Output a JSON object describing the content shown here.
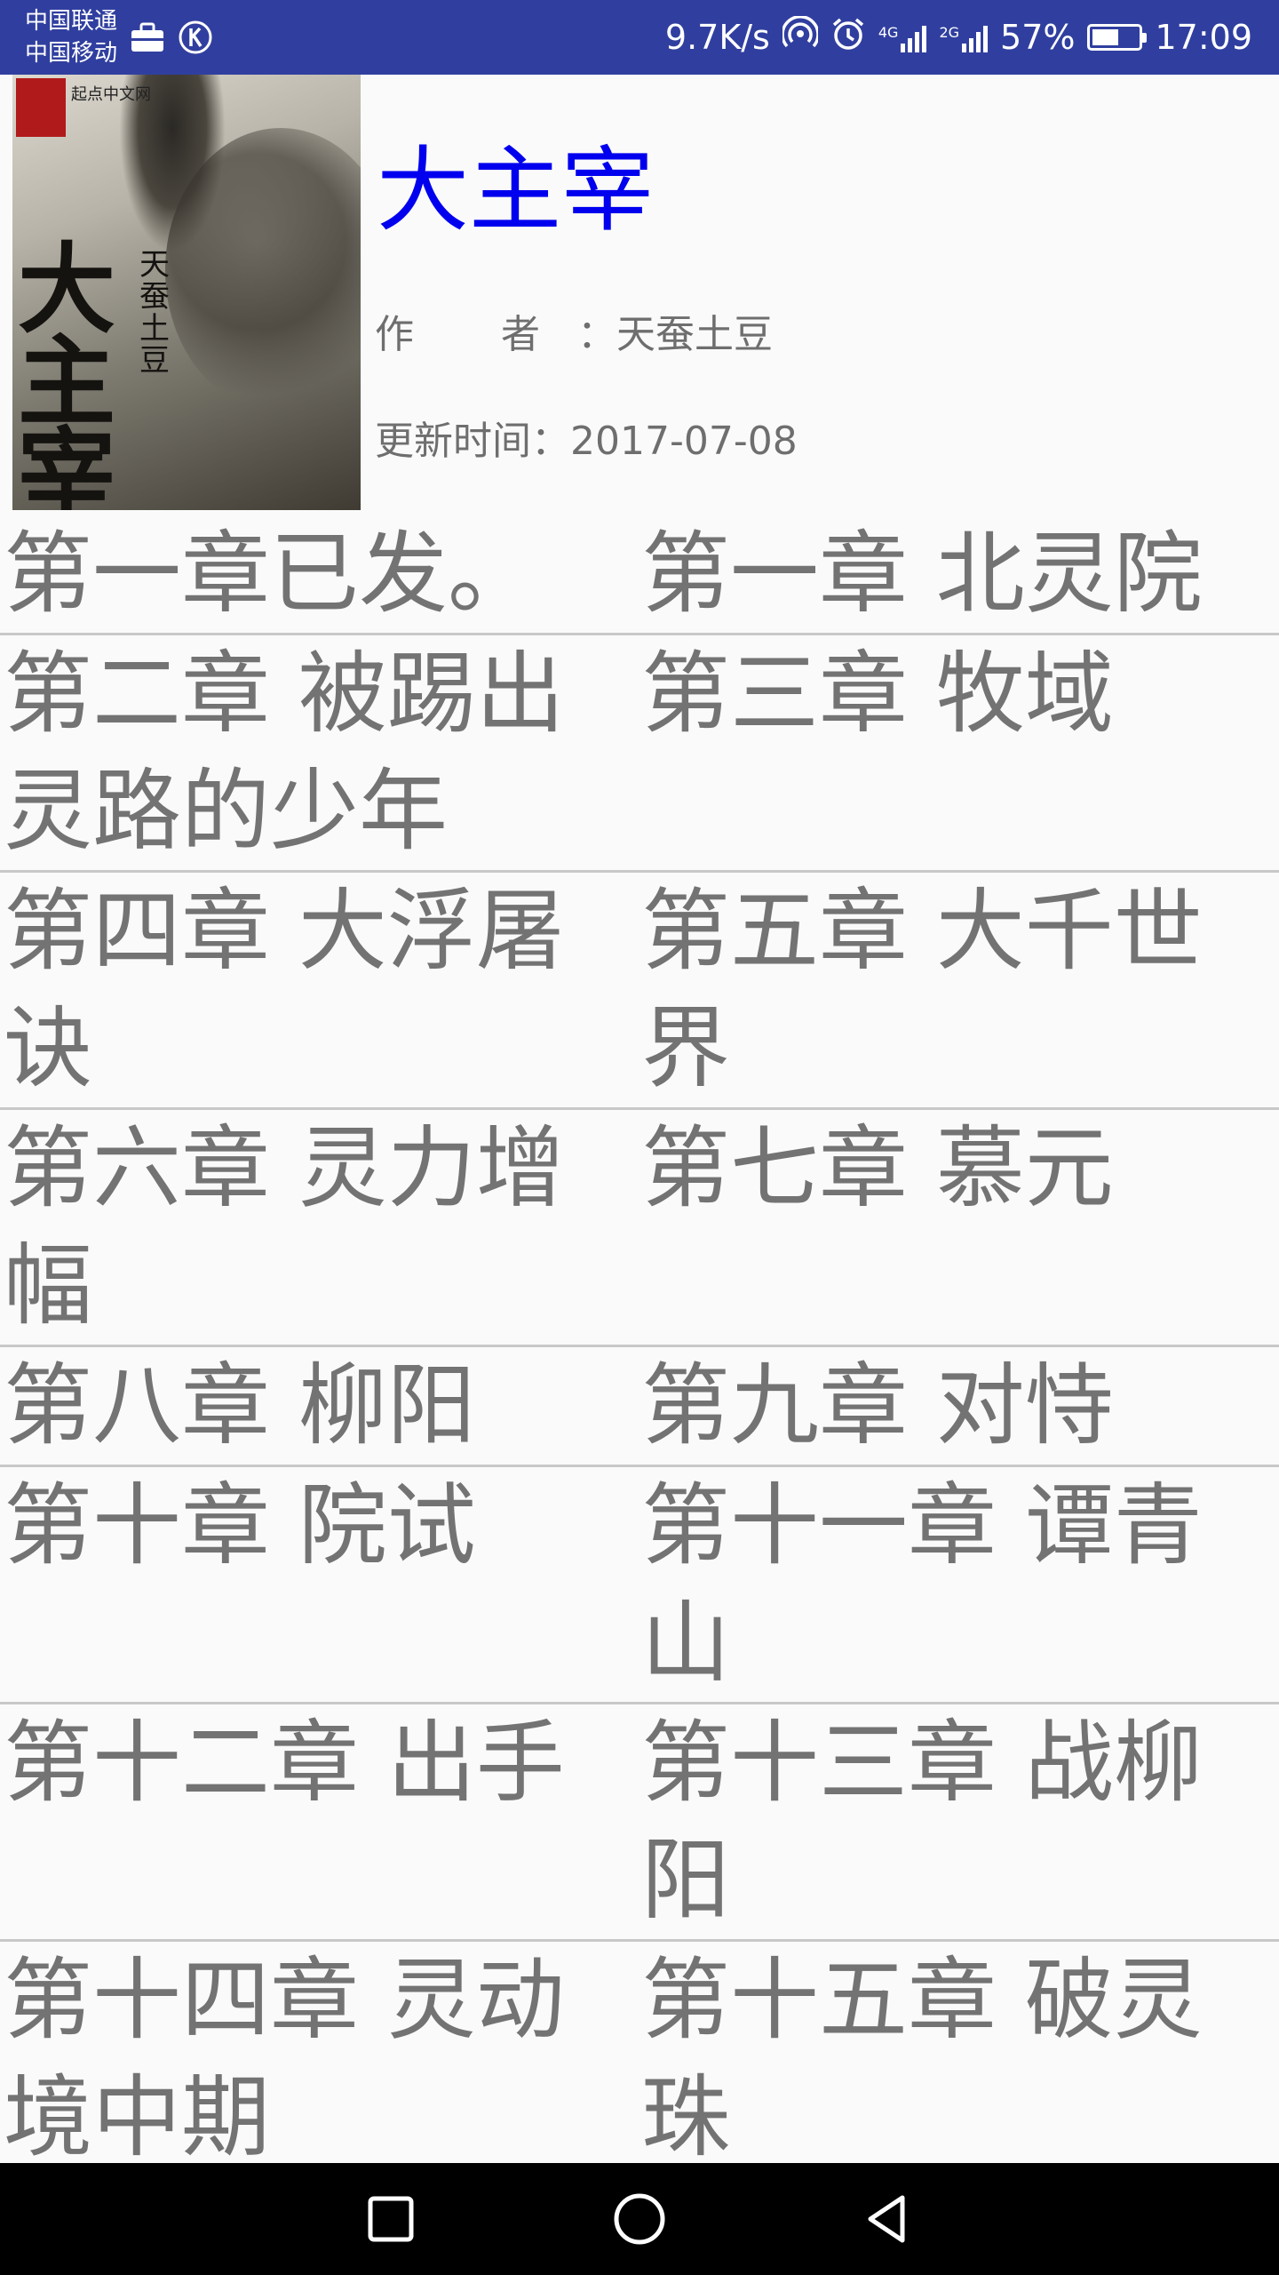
{
  "status_bar": {
    "carrier_1": "中国联通",
    "carrier_2": "中国移动",
    "net_speed": "9.7K/s",
    "tag_4g": "4G",
    "tag_2g": "2G",
    "battery": "57%",
    "battery_level": 0.57,
    "time": "17:09",
    "icons": [
      "briefcase-icon",
      "k-app-icon",
      "hotspot-icon",
      "alarm-icon",
      "signal-icon",
      "battery-icon"
    ]
  },
  "book": {
    "title": "大主宰",
    "author_label": "作 者",
    "author_sep": "：",
    "author": "天蚕土豆",
    "updated_label": "更新时间：",
    "updated": "2017-07-08",
    "cover": {
      "title": "大主宰",
      "author": "天蚕土豆",
      "publisher": "起点中文网"
    }
  },
  "chapters": [
    [
      "第一章已发。",
      "第一章 北灵院"
    ],
    [
      "第二章 被踢出灵路的少年",
      "第三章 牧域"
    ],
    [
      "第四章 大浮屠诀",
      "第五章 大千世界"
    ],
    [
      "第六章 灵力增幅",
      "第七章 慕元"
    ],
    [
      "第八章 柳阳",
      "第九章 对恃"
    ],
    [
      "第十章 院试",
      "第十一章 谭青山"
    ],
    [
      "第十二章 出手",
      "第十三章 战柳阳"
    ],
    [
      "第十四章 灵动境中期",
      "第十五章 破灵珠"
    ]
  ],
  "nav": {
    "icons": [
      "recent-apps-icon",
      "home-icon",
      "back-icon"
    ]
  }
}
